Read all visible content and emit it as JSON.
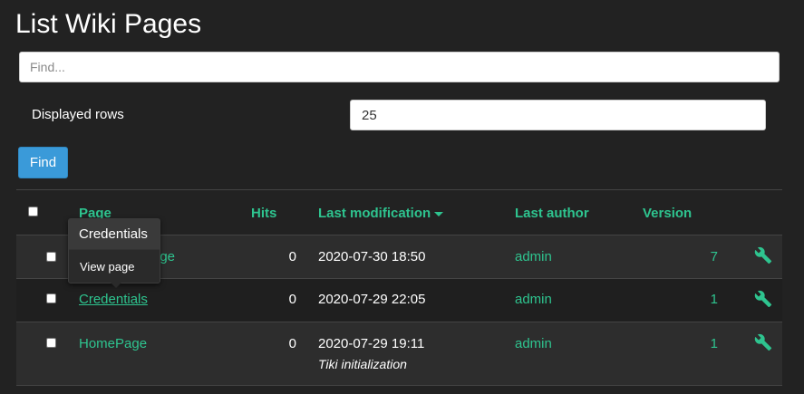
{
  "page": {
    "title": "List Wiki Pages"
  },
  "search": {
    "placeholder": "Find...",
    "value": ""
  },
  "rows_filter": {
    "label": "Displayed rows",
    "value": "25"
  },
  "find_button": {
    "label": "Find"
  },
  "table": {
    "columns": [
      "Page",
      "Hits",
      "Last modification",
      "Last author",
      "Version"
    ],
    "sort_column": "Last modification",
    "sort_direction": "descending",
    "rows": [
      {
        "page": "LoginPage",
        "page_visible": "age",
        "hits": "0",
        "modified": "2020-07-30 18:50",
        "description": "",
        "author": "admin",
        "version": "7"
      },
      {
        "page": "Credentials",
        "hits": "0",
        "modified": "2020-07-29 22:05",
        "description": "",
        "author": "admin",
        "version": "1"
      },
      {
        "page": "HomePage",
        "hits": "0",
        "modified": "2020-07-29 19:11",
        "description": "Tiki initialization",
        "author": "admin",
        "version": "1"
      }
    ]
  },
  "popover": {
    "title": "Credentials",
    "link": "View page"
  },
  "colors": {
    "background": "#222222",
    "accent_green": "#2ec48f",
    "button_blue": "#3a9ad9"
  },
  "icons": {
    "actions": "wrench-icon",
    "sort": "caret-down-icon"
  }
}
